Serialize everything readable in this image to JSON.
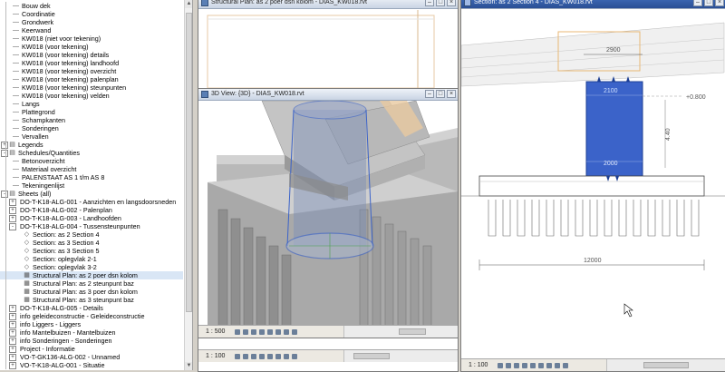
{
  "browser": {
    "items": [
      {
        "label": "Bouw dek",
        "indent": 1,
        "glyph": "line"
      },
      {
        "label": "Coordinatie",
        "indent": 1,
        "glyph": "line"
      },
      {
        "label": "Grondwerk",
        "indent": 1,
        "glyph": "line"
      },
      {
        "label": "Keerwand",
        "indent": 1,
        "glyph": "line"
      },
      {
        "label": "KW018 (niet voor tekening)",
        "indent": 1,
        "glyph": "line"
      },
      {
        "label": "KW018 (voor tekening)",
        "indent": 1,
        "glyph": "line"
      },
      {
        "label": "KW018 (voor tekening) details",
        "indent": 1,
        "glyph": "line"
      },
      {
        "label": "KW018 (voor tekening) landhoofd",
        "indent": 1,
        "glyph": "line"
      },
      {
        "label": "KW018 (voor tekening) overzicht",
        "indent": 1,
        "glyph": "line"
      },
      {
        "label": "KW018 (voor tekening) palenplan",
        "indent": 1,
        "glyph": "line"
      },
      {
        "label": "KW018 (voor tekening) steunpunten",
        "indent": 1,
        "glyph": "line"
      },
      {
        "label": "KW018 (voor tekening) velden",
        "indent": 1,
        "glyph": "line"
      },
      {
        "label": "Langs",
        "indent": 1,
        "glyph": "line"
      },
      {
        "label": "Plattegrond",
        "indent": 1,
        "glyph": "line"
      },
      {
        "label": "Schampkanten",
        "indent": 1,
        "glyph": "line"
      },
      {
        "label": "Sonderingen",
        "indent": 1,
        "glyph": "line"
      },
      {
        "label": "Vervallen",
        "indent": 1,
        "glyph": "line"
      },
      {
        "label": "Legends",
        "indent": 0,
        "glyph": "folder",
        "expander": "+"
      },
      {
        "label": "Schedules/Quantities",
        "indent": 0,
        "glyph": "folder",
        "expander": "-"
      },
      {
        "label": "Betonoverzicht",
        "indent": 1,
        "glyph": "line"
      },
      {
        "label": "Materiaal overzicht",
        "indent": 1,
        "glyph": "line"
      },
      {
        "label": "PALENSTAAT AS 1 t/m AS 8",
        "indent": 1,
        "glyph": "line"
      },
      {
        "label": "Tekeningenlijst",
        "indent": 1,
        "glyph": "line"
      },
      {
        "label": "Sheets (all)",
        "indent": 0,
        "glyph": "folder",
        "expander": "-"
      },
      {
        "label": "DO-T-K18-ALG-001 - Aanzichten en langsdoorsneden",
        "indent": 1,
        "glyph": "none",
        "expander": "+"
      },
      {
        "label": "DO-T-K18-ALG-002 - Palenplan",
        "indent": 1,
        "glyph": "none",
        "expander": "+"
      },
      {
        "label": "DO-T-K18-ALG-003 - Landhoofden",
        "indent": 1,
        "glyph": "none",
        "expander": "+"
      },
      {
        "label": "DO-T-K18-ALG-004 - Tussensteunpunten",
        "indent": 1,
        "glyph": "none",
        "expander": "-"
      },
      {
        "label": "Section: as 2 Section 4",
        "indent": 2,
        "glyph": "diamond"
      },
      {
        "label": "Section: as 3 Section 4",
        "indent": 2,
        "glyph": "diamond"
      },
      {
        "label": "Section: as 3 Section 5",
        "indent": 2,
        "glyph": "diamond"
      },
      {
        "label": "Section: oplegvlak 2-1",
        "indent": 2,
        "glyph": "diamond"
      },
      {
        "label": "Section: oplegvlak 3-2",
        "indent": 2,
        "glyph": "diamond"
      },
      {
        "label": "Structural Plan: as 2 poer dsn kolom",
        "indent": 2,
        "glyph": "plan",
        "selected": true
      },
      {
        "label": "Structural Plan: as 2 steunpunt baz",
        "indent": 2,
        "glyph": "plan"
      },
      {
        "label": "Structural Plan: as 3 poer dsn kolom",
        "indent": 2,
        "glyph": "plan"
      },
      {
        "label": "Structural Plan: as 3 steunpunt baz",
        "indent": 2,
        "glyph": "plan"
      },
      {
        "label": "DO-T-K18-ALG-005 - Details",
        "indent": 1,
        "glyph": "none",
        "expander": "+"
      },
      {
        "label": "info     geleideconstructie - Geleideconstructie",
        "indent": 1,
        "glyph": "none",
        "expander": "+"
      },
      {
        "label": "info     Liggers - Liggers",
        "indent": 1,
        "glyph": "none",
        "expander": "+"
      },
      {
        "label": "info     Mantelbuizen - Mantelbuizen",
        "indent": 1,
        "glyph": "none",
        "expander": "+"
      },
      {
        "label": "info     Sonderingen - Sonderingen",
        "indent": 1,
        "glyph": "none",
        "expander": "+"
      },
      {
        "label": "Project - Informatie",
        "indent": 1,
        "glyph": "none",
        "expander": "+"
      },
      {
        "label": "VO-T-GK136-ALG-002 - Unnamed",
        "indent": 1,
        "glyph": "none",
        "expander": "+"
      },
      {
        "label": "VO-T-K18-ALG-001 - Situatie",
        "indent": 1,
        "glyph": "none",
        "expander": "+"
      }
    ]
  },
  "views": {
    "plan": {
      "title": "Structural Plan: as 2 poer dsn kolom - DIAS_KW018.rvt"
    },
    "view3d": {
      "title": "3D View: {3D} - DIAS_KW018.rvt",
      "scale": "1 : 500"
    },
    "bottom_left": {
      "scale": "1 : 100"
    },
    "section": {
      "title": "Section: as 2 Section 4 - DIAS_KW018.rvt",
      "scale": "1 : 100",
      "dims": {
        "top": "2900",
        "upper": "2100",
        "mid": "2000",
        "bottom": "12000",
        "level": "+0.800",
        "side": "4.40"
      }
    }
  },
  "colors": {
    "accent": "#3b63c9",
    "column": "#4a6fd0",
    "highlight": "#d9e6f5"
  }
}
